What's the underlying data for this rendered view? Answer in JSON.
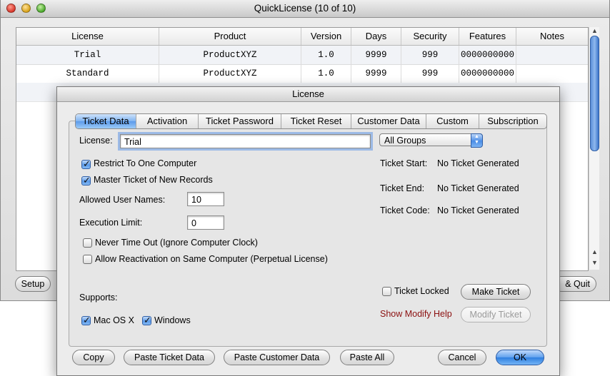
{
  "main_window": {
    "title": "QuickLicense (10 of 10)",
    "table": {
      "columns": [
        "License",
        "Product",
        "Version",
        "Days",
        "Security",
        "Features",
        "Notes"
      ],
      "rows": [
        [
          "Trial",
          "ProductXYZ",
          "1.0",
          "9999",
          "999",
          "0000000000",
          ""
        ],
        [
          "Standard",
          "ProductXYZ",
          "1.0",
          "9999",
          "999",
          "0000000000",
          ""
        ]
      ]
    },
    "buttons": {
      "setup": "Setup",
      "save_quit": "& Quit"
    }
  },
  "dialog": {
    "title": "License",
    "tabs": [
      {
        "label": "Ticket Data",
        "active": true
      },
      {
        "label": "Activation",
        "active": false
      },
      {
        "label": "Ticket Password",
        "active": false
      },
      {
        "label": "Ticket Reset",
        "active": false
      },
      {
        "label": "Customer Data",
        "active": false
      },
      {
        "label": "Custom",
        "active": false
      },
      {
        "label": "Subscription",
        "active": false
      }
    ],
    "license_label": "License:",
    "license_value": "Trial",
    "group_select": "All Groups",
    "checkboxes": {
      "restrict": {
        "label": "Restrict To One Computer",
        "checked": true
      },
      "master": {
        "label": "Master Ticket of New Records",
        "checked": true
      },
      "never_timeout": {
        "label": "Never Time Out (Ignore Computer Clock)",
        "checked": false
      },
      "reactivation": {
        "label": "Allow Reactivation on Same Computer (Perpetual License)",
        "checked": false
      },
      "ticket_locked": {
        "label": "Ticket Locked",
        "checked": false
      },
      "mac": {
        "label": "Mac OS X",
        "checked": true
      },
      "windows": {
        "label": "Windows",
        "checked": true
      }
    },
    "allowed_user_names": {
      "label": "Allowed User Names:",
      "value": "10"
    },
    "execution_limit": {
      "label": "Execution Limit:",
      "value": "0"
    },
    "ticket_info": [
      {
        "label": "Ticket Start:",
        "value": "No Ticket Generated"
      },
      {
        "label": "Ticket End:",
        "value": "No Ticket Generated"
      },
      {
        "label": "Ticket Code:",
        "value": "No Ticket Generated"
      }
    ],
    "supports_label": "Supports:",
    "make_ticket": "Make Ticket",
    "modify_ticket": "Modify Ticket",
    "show_modify_help": "Show Modify Help",
    "bottom_buttons": {
      "copy": "Copy",
      "paste_ticket": "Paste Ticket Data",
      "paste_customer": "Paste Customer Data",
      "paste_all": "Paste All",
      "cancel": "Cancel",
      "ok": "OK"
    }
  }
}
